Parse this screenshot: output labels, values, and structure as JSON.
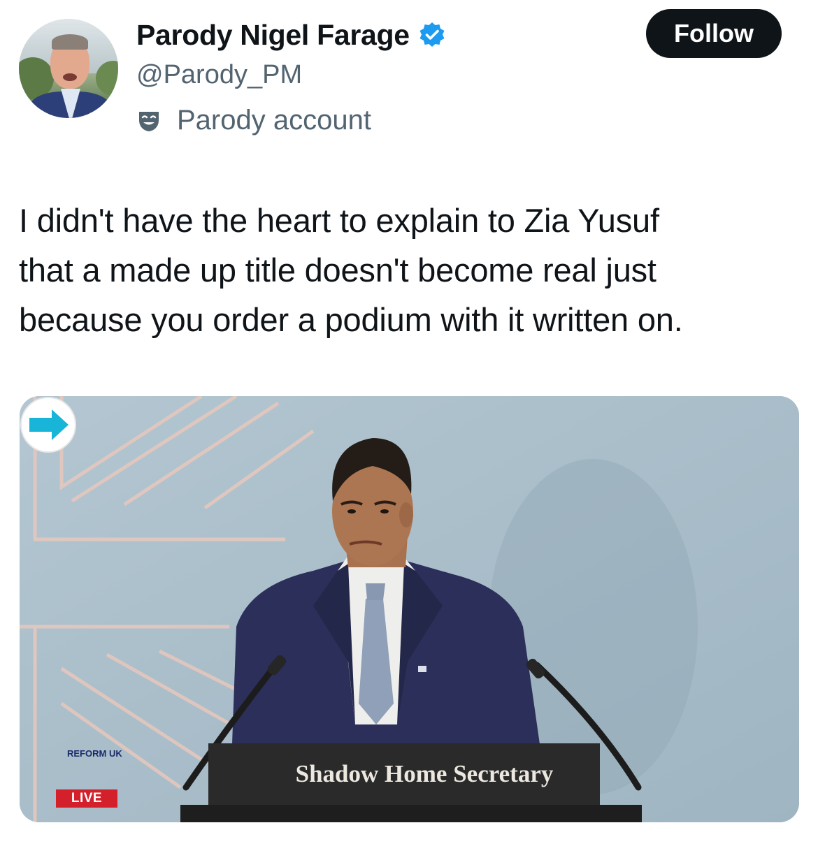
{
  "account": {
    "display_name": "Parody Nigel Farage",
    "handle": "@Parody_PM",
    "parody_label": "Parody account",
    "verified": true
  },
  "actions": {
    "follow_label": "Follow"
  },
  "tweet": {
    "text": "I didn't have the heart to explain to Zia Yusuf\nthat a made up title doesn't become real just\nbecause you order a podium with it written on."
  },
  "media": {
    "podium_sign": "Shadow Home Secretary",
    "logo_text": "REFORM UK",
    "live_badge": "LIVE"
  },
  "colors": {
    "verified_blue": "#1d9bf0",
    "follow_bg": "#0f1419",
    "secondary_text": "#536471",
    "live_red": "#d3202b"
  },
  "icons": {
    "verified": "verified-badge-icon",
    "parody": "parody-mask-icon"
  }
}
